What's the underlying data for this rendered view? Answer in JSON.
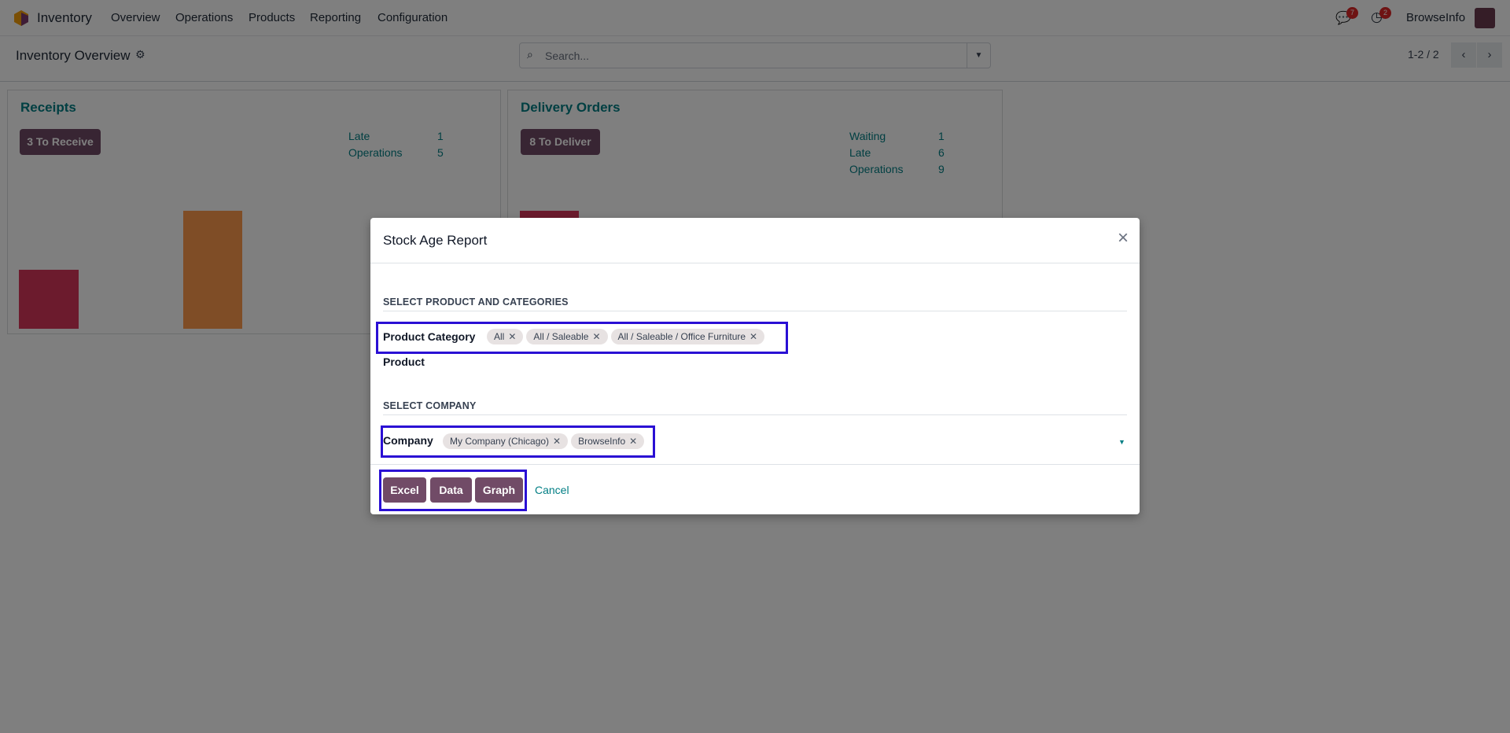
{
  "navbar": {
    "app_name": "Inventory",
    "menu": [
      "Overview",
      "Operations",
      "Products",
      "Reporting",
      "Configuration"
    ],
    "messages_count": "7",
    "activities_count": "2",
    "user_name": "BrowseInfo"
  },
  "control_panel": {
    "title": "Inventory Overview",
    "search_placeholder": "Search...",
    "pager": "1-2 / 2"
  },
  "cards": [
    {
      "title": "Receipts",
      "button": "3 To Receive",
      "stats": [
        {
          "label": "Late",
          "value": "1"
        },
        {
          "label": "Operations",
          "value": "5"
        }
      ]
    },
    {
      "title": "Delivery Orders",
      "button": "8 To Deliver",
      "stats": [
        {
          "label": "Waiting",
          "value": "1"
        },
        {
          "label": "Late",
          "value": "6"
        },
        {
          "label": "Operations",
          "value": "9"
        }
      ]
    }
  ],
  "colors": {
    "primary": "#714b67",
    "teal": "#017e84",
    "highlight": "#2a0fd4"
  },
  "modal": {
    "title": "Stock Age Report",
    "section1": "SELECT PRODUCT AND CATEGORIES",
    "product_category_label": "Product Category",
    "product_categories": [
      "All",
      "All / Saleable",
      "All / Saleable / Office Furniture"
    ],
    "product_label": "Product",
    "section2": "SELECT COMPANY",
    "company_label": "Company",
    "companies": [
      "My Company (Chicago)",
      "BrowseInfo"
    ],
    "buttons": {
      "excel": "Excel",
      "data": "Data",
      "graph": "Graph",
      "cancel": "Cancel"
    }
  }
}
